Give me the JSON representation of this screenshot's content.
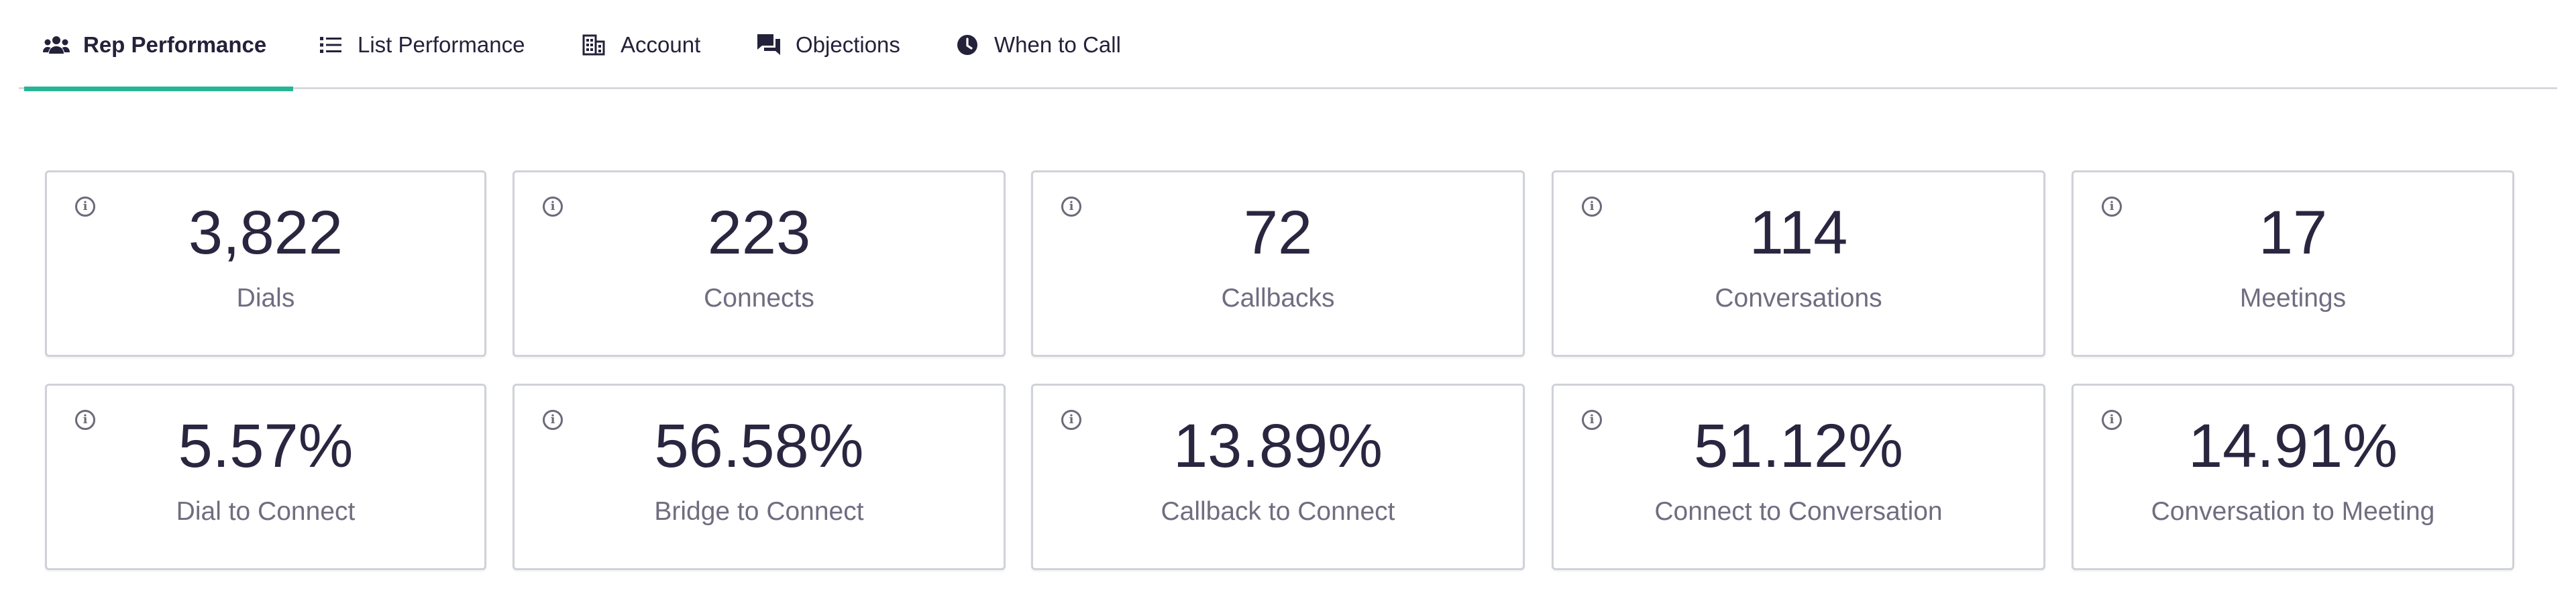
{
  "tabs": [
    {
      "label": "Rep Performance",
      "icon": "users-icon",
      "active": true
    },
    {
      "label": "List Performance",
      "icon": "list-icon",
      "active": false
    },
    {
      "label": "Account",
      "icon": "building-icon",
      "active": false
    },
    {
      "label": "Objections",
      "icon": "chat-icon",
      "active": false
    },
    {
      "label": "When to Call",
      "icon": "clock-icon",
      "active": false
    }
  ],
  "metrics_row1": [
    {
      "value": "3,822",
      "label": "Dials"
    },
    {
      "value": "223",
      "label": "Connects"
    },
    {
      "value": "72",
      "label": "Callbacks"
    },
    {
      "value": "114",
      "label": "Conversations"
    },
    {
      "value": "17",
      "label": "Meetings"
    }
  ],
  "metrics_row2": [
    {
      "value": "5.57%",
      "label": "Dial to Connect"
    },
    {
      "value": "56.58%",
      "label": "Bridge to Connect"
    },
    {
      "value": "13.89%",
      "label": "Callback to Connect"
    },
    {
      "value": "51.12%",
      "label": "Connect to Conversation"
    },
    {
      "value": "14.91%",
      "label": "Conversation to Meeting"
    }
  ],
  "colors": {
    "accent": "#28b596",
    "text_primary": "#2a2640",
    "text_secondary": "#6f6d80",
    "card_border": "#cfd2d8"
  }
}
